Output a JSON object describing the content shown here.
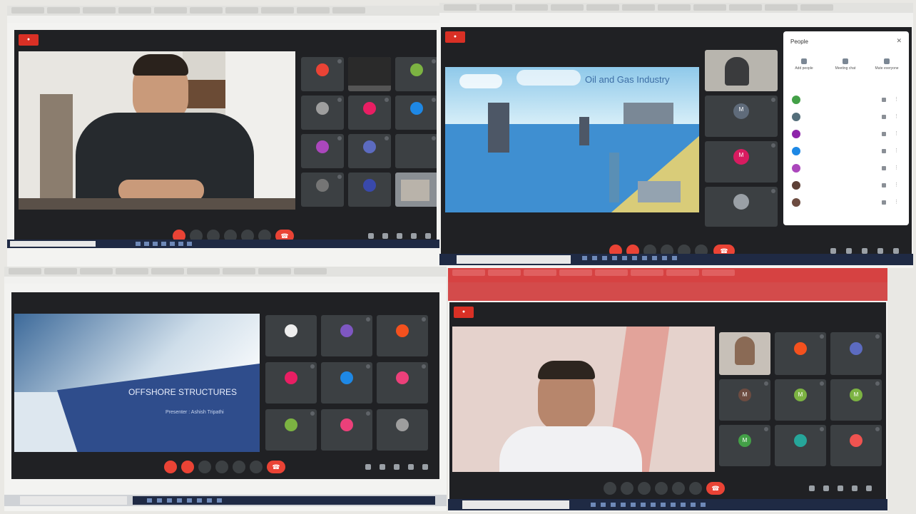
{
  "tr": {
    "slide_title": "Oil and Gas Industry",
    "people_title": "People",
    "people_actions": [
      {
        "label": "Add people"
      },
      {
        "label": "Meeting chat"
      },
      {
        "label": "Mute everyone"
      }
    ]
  },
  "bl": {
    "slide_line1": "OFFSHORE STRUCTURES",
    "slide_line2": "Presenter : Ashish Tripathi"
  },
  "icons": {
    "mic": "microphone-icon",
    "cam": "camera-icon",
    "captions": "captions-icon",
    "present": "present-icon",
    "raise_hand": "raise-hand-icon",
    "more": "more-options-icon",
    "end_call": "end-call-icon",
    "info": "info-icon",
    "people": "people-icon",
    "chat": "chat-icon",
    "activities": "activities-icon",
    "lock": "lock-icon"
  },
  "colors": {
    "meet_bg": "#202124",
    "tile_bg": "#3c4043",
    "end_call": "#ea4335",
    "record": "#d93025"
  }
}
